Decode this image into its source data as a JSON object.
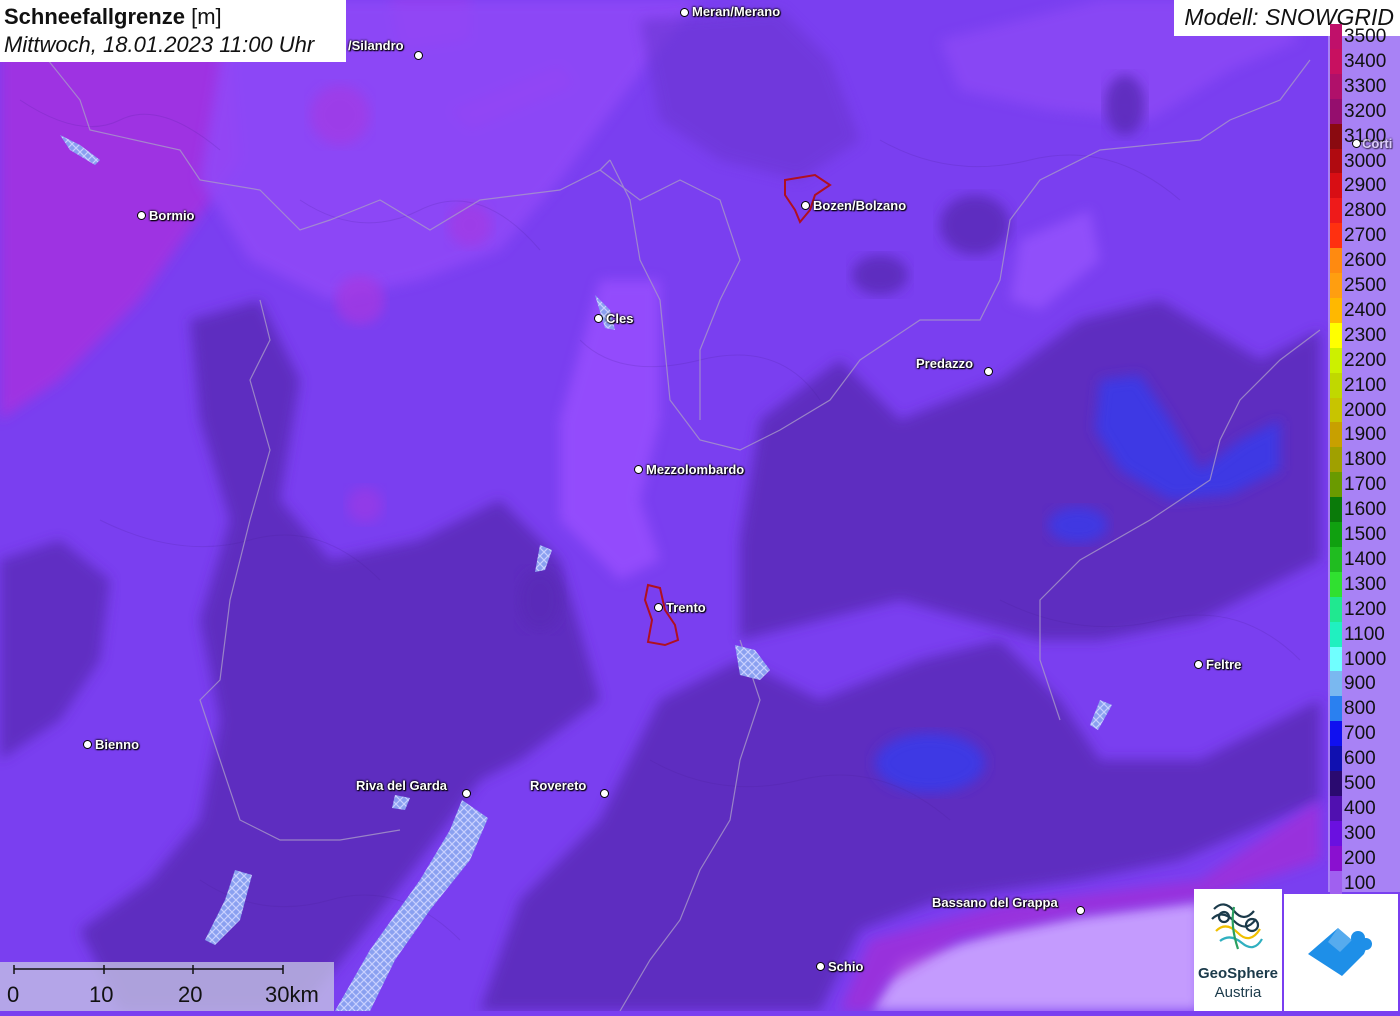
{
  "title": {
    "parameter": "Schneefallgrenze",
    "unit": "[m]",
    "datetime": "Mittwoch, 18.01.2023 11:00 Uhr"
  },
  "model": "Modell: SNOWGRID",
  "legend": [
    {
      "label": "3500",
      "color": "#c0106a"
    },
    {
      "label": "3400",
      "color": "#c81060"
    },
    {
      "label": "3300",
      "color": "#b0106a"
    },
    {
      "label": "3200",
      "color": "#950e6e"
    },
    {
      "label": "3100",
      "color": "#8a0a10"
    },
    {
      "label": "3000",
      "color": "#b00a10"
    },
    {
      "label": "2900",
      "color": "#d80e14"
    },
    {
      "label": "2800",
      "color": "#ee1a1a"
    },
    {
      "label": "2700",
      "color": "#ff3010"
    },
    {
      "label": "2600",
      "color": "#ff8a10"
    },
    {
      "label": "2500",
      "color": "#ff9e10"
    },
    {
      "label": "2400",
      "color": "#ffb800"
    },
    {
      "label": "2300",
      "color": "#ffff00"
    },
    {
      "label": "2200",
      "color": "#ccf000"
    },
    {
      "label": "2100",
      "color": "#c0d800"
    },
    {
      "label": "2000",
      "color": "#c8c400"
    },
    {
      "label": "1900",
      "color": "#c8a000"
    },
    {
      "label": "1800",
      "color": "#a0a000"
    },
    {
      "label": "1700",
      "color": "#6a9a00"
    },
    {
      "label": "1600",
      "color": "#0a7a0a"
    },
    {
      "label": "1500",
      "color": "#10a010"
    },
    {
      "label": "1400",
      "color": "#20bc20"
    },
    {
      "label": "1300",
      "color": "#30e030"
    },
    {
      "label": "1200",
      "color": "#20e890"
    },
    {
      "label": "1100",
      "color": "#20f0c0"
    },
    {
      "label": "1000",
      "color": "#70ffff"
    },
    {
      "label": "900",
      "color": "#7ab8f0"
    },
    {
      "label": "800",
      "color": "#2a80f0"
    },
    {
      "label": "700",
      "color": "#1010f0"
    },
    {
      "label": "600",
      "color": "#1010b0"
    },
    {
      "label": "500",
      "color": "#2a0a70"
    },
    {
      "label": "400",
      "color": "#5010b0"
    },
    {
      "label": "300",
      "color": "#6a10e0"
    },
    {
      "label": "200",
      "color": "#8a10d0"
    },
    {
      "label": "100",
      "color": "#a060f0"
    }
  ],
  "cities": [
    {
      "name": "Meran/Merano"
    },
    {
      "name": "/Silandro"
    },
    {
      "name": "Bormio"
    },
    {
      "name": "Bozen/Bolzano"
    },
    {
      "name": "Cles"
    },
    {
      "name": "Predazzo"
    },
    {
      "name": "Mezzolombardo"
    },
    {
      "name": "Trento"
    },
    {
      "name": "Feltre"
    },
    {
      "name": "Bienno"
    },
    {
      "name": "Riva del Garda"
    },
    {
      "name": "Rovereto"
    },
    {
      "name": "Bassano del Grappa"
    },
    {
      "name": "Schio"
    },
    {
      "name": "Corti"
    }
  ],
  "scale": {
    "ticks": [
      "0",
      "10",
      "20",
      "30km"
    ]
  },
  "logos": {
    "geosphere_line1": "GeoSphere",
    "geosphere_line2": "Austria"
  },
  "colors": {
    "base": "#7a3ff0",
    "dark": "#5a2cb8",
    "light": "#9a50ff",
    "magenta": "#a42ee8",
    "blue": "#3a3ae0"
  }
}
